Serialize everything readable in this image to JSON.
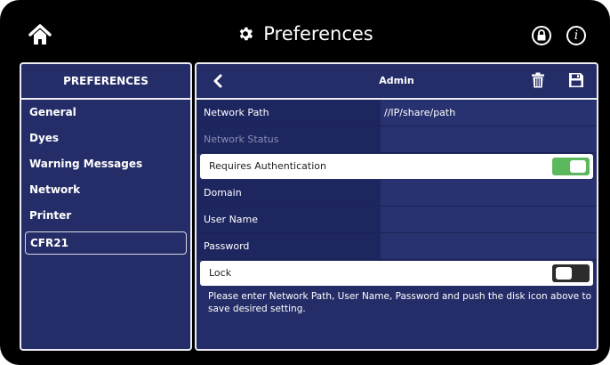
{
  "header": {
    "title": "Preferences",
    "info_glyph": "i",
    "icons": [
      "home-icon",
      "gear-icon",
      "lock-icon",
      "info-icon"
    ]
  },
  "sidebar": {
    "title": "PREFERENCES",
    "items": [
      {
        "label": "General"
      },
      {
        "label": "Dyes"
      },
      {
        "label": "Warning Messages"
      },
      {
        "label": "Network"
      },
      {
        "label": "Printer"
      },
      {
        "label": "CFR21",
        "selected": true
      }
    ]
  },
  "panel": {
    "title": "Admin",
    "fields": {
      "network_path": {
        "label": "Network Path",
        "value": "//IP/share/path"
      },
      "network_status": {
        "label": "Network Status",
        "value": ""
      },
      "requires_auth": {
        "label": "Requires Authentication",
        "on": true
      },
      "domain": {
        "label": "Domain",
        "value": ""
      },
      "user_name": {
        "label": "User Name",
        "value": ""
      },
      "password": {
        "label": "Password",
        "value": ""
      },
      "lock": {
        "label": "Lock",
        "on": false
      }
    },
    "note": "Please enter Network Path, User Name, Password and push the disk icon above to save desired setting."
  },
  "colors": {
    "background": "#000000",
    "panel": "#252d68",
    "toggle_on": "#5cb85c",
    "toggle_off": "#2c2c2c"
  }
}
